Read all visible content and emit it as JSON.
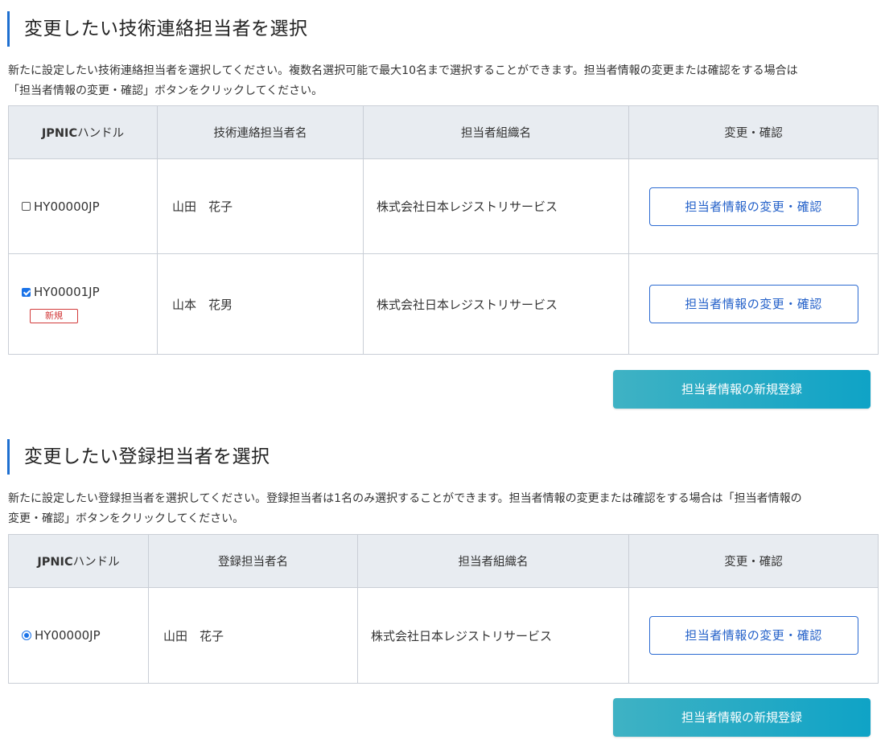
{
  "tech_section": {
    "title": "変更したい技術連絡担当者を選択",
    "description_line1": "新たに設定したい技術連絡担当者を選択してください。複数名選択可能で最大10名まで選択することができます。担当者情報の変更または確認をする場合は",
    "description_line2": "「担当者情報の変更・確認」ボタンをクリックしてください。",
    "columns": [
      "JPNICハンドル",
      "技術連絡担当者名",
      "担当者組織名",
      "変更・確認"
    ],
    "rows": [
      {
        "handle": "HY00000JP",
        "checked": false,
        "name": "山田　花子",
        "org": "株式会社日本レジストリサービス",
        "button": "担当者情報の変更・確認"
      },
      {
        "handle": "HY00001JP",
        "checked": true,
        "badge": "新規",
        "name": "山本　花男",
        "org": "株式会社日本レジストリサービス",
        "button": "担当者情報の変更・確認"
      }
    ],
    "register_button": "担当者情報の新規登録"
  },
  "reg_section": {
    "title": "変更したい登録担当者を選択",
    "description_line1": "新たに設定したい登録担当者を選択してください。登録担当者は1名のみ選択することができます。担当者情報の変更または確認をする場合は「担当者情報の",
    "description_line2": "変更・確認」ボタンをクリックしてください。",
    "columns": [
      "JPNICハンドル",
      "登録担当者名",
      "担当者組織名",
      "変更・確認"
    ],
    "rows": [
      {
        "handle": "HY00000JP",
        "selected": true,
        "name": "山田　花子",
        "org": "株式会社日本レジストリサービス",
        "button": "担当者情報の変更・確認"
      }
    ],
    "register_button": "担当者情報の新規登録"
  },
  "colors": {
    "accent": "#1e6fd0",
    "outline_button": "#2c6bd2",
    "primary_button": "#0fa3c6",
    "badge": "#d23a3a",
    "header_bg": "#e8ecf1"
  }
}
